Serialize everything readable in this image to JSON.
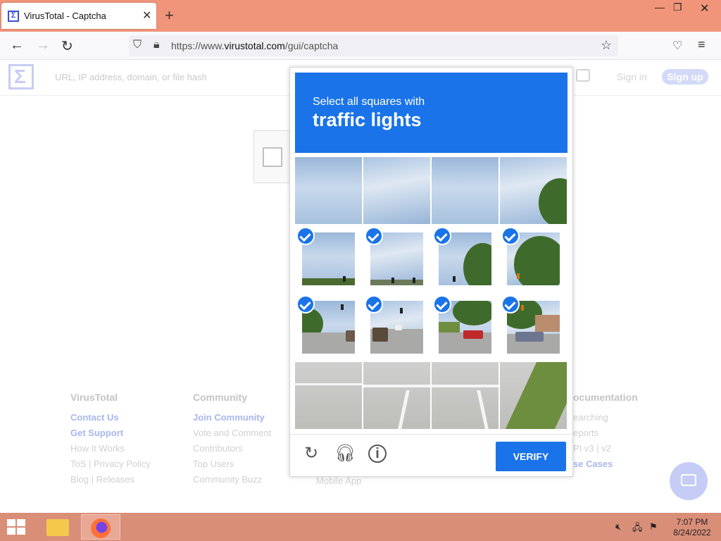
{
  "browser": {
    "tab_title": "VirusTotal - Captcha",
    "url_prefix": "https://www.",
    "url_domain": "virustotal.com",
    "url_path": "/gui/captcha"
  },
  "vt": {
    "search_placeholder": "URL, IP address, domain, or file hash",
    "signin": "Sign in",
    "signup": "Sign up"
  },
  "footer": {
    "col1": {
      "heading": "VirusTotal",
      "links": [
        "Contact Us",
        "Get Support",
        "How It Works",
        "ToS | Privacy Policy",
        "Blog | Releases"
      ]
    },
    "col2": {
      "heading": "Community",
      "links": [
        "Join Community",
        "Vote and Comment",
        "Contributors",
        "Top Users",
        "Community Buzz"
      ]
    },
    "col3": {
      "links": [
        "Mobile App"
      ]
    },
    "col4": {
      "heading": "ocumentation",
      "links": [
        "earching",
        "eports",
        "PI v3 | v2",
        "se Cases"
      ]
    }
  },
  "captcha": {
    "prompt_line1": "Select all squares with",
    "prompt_line2": "traffic lights",
    "verify_label": "VERIFY",
    "selected_tiles": [
      4,
      5,
      6,
      7,
      8,
      9,
      10,
      11
    ]
  },
  "taskbar": {
    "time": "7:07 PM",
    "date": "8/24/2022"
  }
}
